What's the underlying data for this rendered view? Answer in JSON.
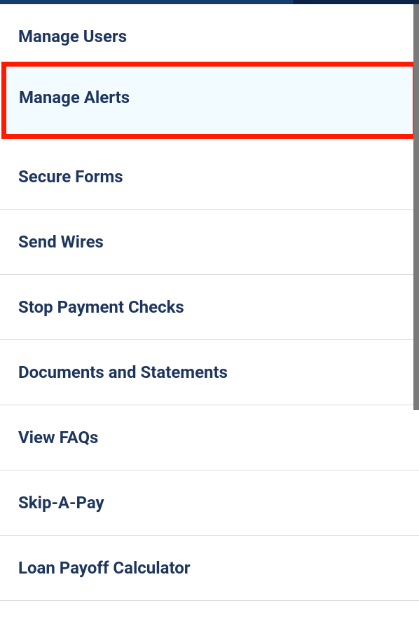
{
  "menu": {
    "items": [
      {
        "label": "Manage Users",
        "highlighted": false
      },
      {
        "label": "Manage Alerts",
        "highlighted": true
      },
      {
        "label": "Secure Forms",
        "highlighted": false
      },
      {
        "label": "Send Wires",
        "highlighted": false
      },
      {
        "label": "Stop Payment Checks",
        "highlighted": false
      },
      {
        "label": "Documents and Statements",
        "highlighted": false
      },
      {
        "label": "View FAQs",
        "highlighted": false
      },
      {
        "label": "Skip-A-Pay",
        "highlighted": false
      },
      {
        "label": "Loan Payoff Calculator",
        "highlighted": false
      }
    ]
  },
  "colors": {
    "highlight_border": "#ff1a00",
    "highlight_bg": "#f2fbff",
    "text": "#1e365e",
    "divider": "#dcdcdc"
  }
}
